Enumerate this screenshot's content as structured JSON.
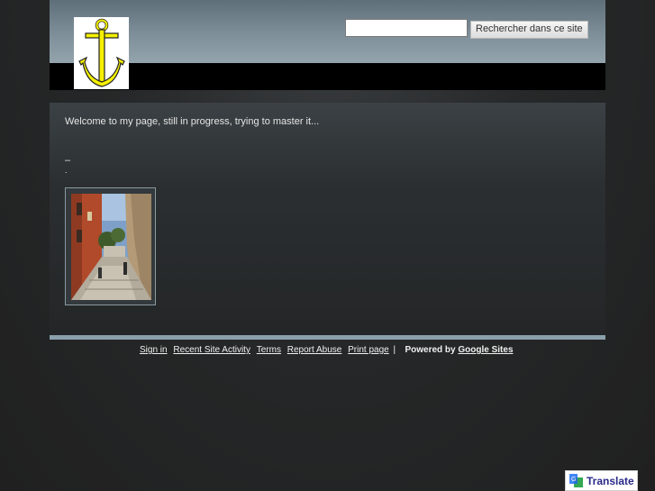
{
  "header": {
    "search": {
      "value": "",
      "placeholder": ""
    },
    "search_button_label": "Rechercher dans ce site",
    "logo_icon": "anchor-icon"
  },
  "main": {
    "welcome_text": "Welcome to my page, still in progress, trying to master it...",
    "dash_text": "–",
    "dot_text": "."
  },
  "footer": {
    "links": [
      "Sign in",
      "Recent Site Activity",
      "Terms",
      "Report Abuse",
      "Print page"
    ],
    "separator": "|",
    "powered_by": "Powered by",
    "powered_link": "Google Sites"
  },
  "translate": {
    "label": "Translate",
    "icon": "google-translate-icon"
  },
  "colors": {
    "header_bar": "#000000",
    "footer_rule": "#8aa0ab",
    "anchor": "#f5f000"
  }
}
